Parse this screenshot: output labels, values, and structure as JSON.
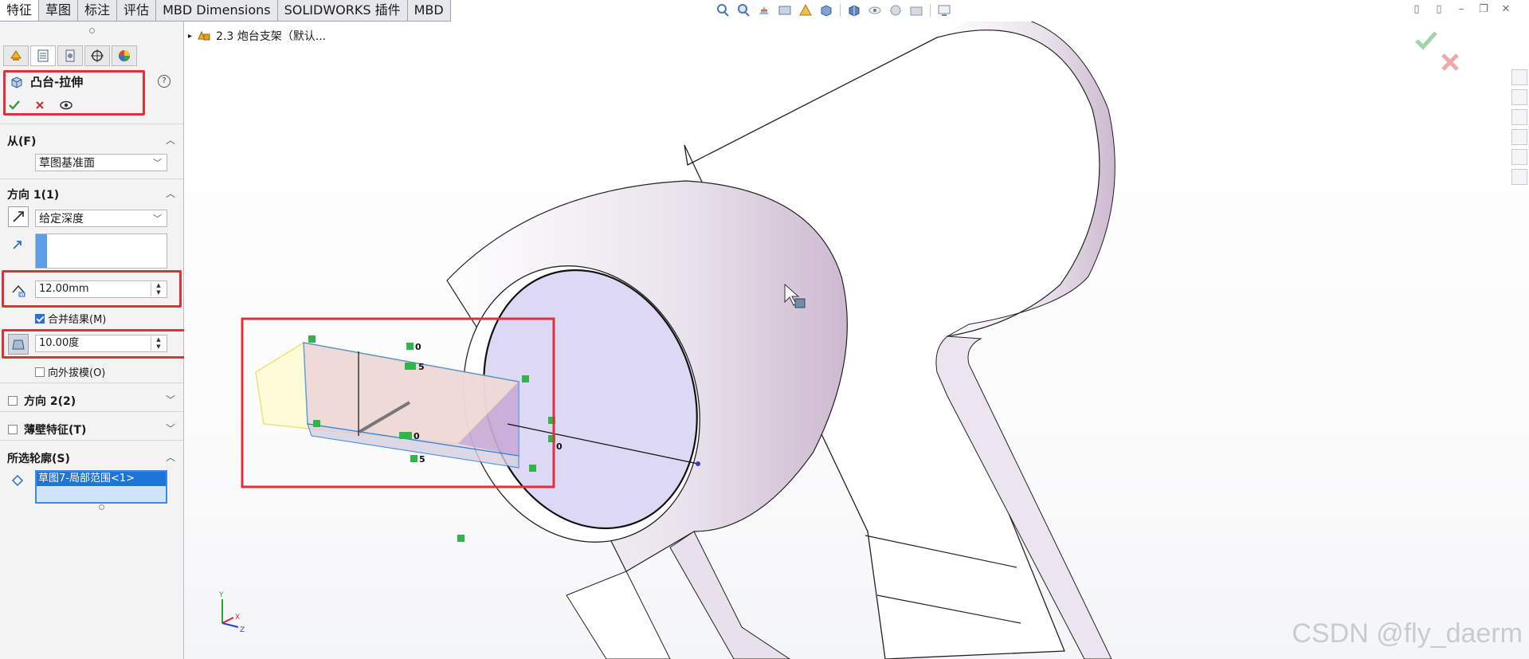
{
  "tabs": [
    {
      "label": "特征",
      "active": true
    },
    {
      "label": "草图",
      "active": false
    },
    {
      "label": "标注",
      "active": false
    },
    {
      "label": "评估",
      "active": false
    },
    {
      "label": "MBD Dimensions",
      "active": false
    },
    {
      "label": "SOLIDWORKS 插件",
      "active": false
    },
    {
      "label": "MBD",
      "active": false
    }
  ],
  "feature": {
    "title": "凸台-拉伸",
    "help": "?"
  },
  "from": {
    "header": "从(F)",
    "value": "草图基准面"
  },
  "direction1": {
    "header": "方向 1(1)",
    "end_condition": "给定深度",
    "depth": "12.00mm",
    "merge_label": "合并结果(M)",
    "merge_checked": true,
    "draft_angle": "10.00度",
    "draft_outward_label": "向外拔模(O)",
    "draft_outward_checked": false
  },
  "direction2": {
    "header": "方向 2(2)",
    "checked": false
  },
  "thin": {
    "header": "薄壁特征(T)",
    "checked": false
  },
  "contours": {
    "header": "所选轮廓(S)",
    "item": "草图7-局部范围<1>"
  },
  "tree": {
    "node": "2.3 炮台支架（默认..."
  },
  "dimensions": [
    "0",
    "5",
    "0",
    "5",
    "0"
  ],
  "triad": {
    "x": "X",
    "y": "Y",
    "z": "Z"
  },
  "watermark": "CSDN @fly_daerm",
  "colors": {
    "accent": "#2b6fd6",
    "highlight": "#e0313a",
    "ok": "#2e9e3a"
  }
}
